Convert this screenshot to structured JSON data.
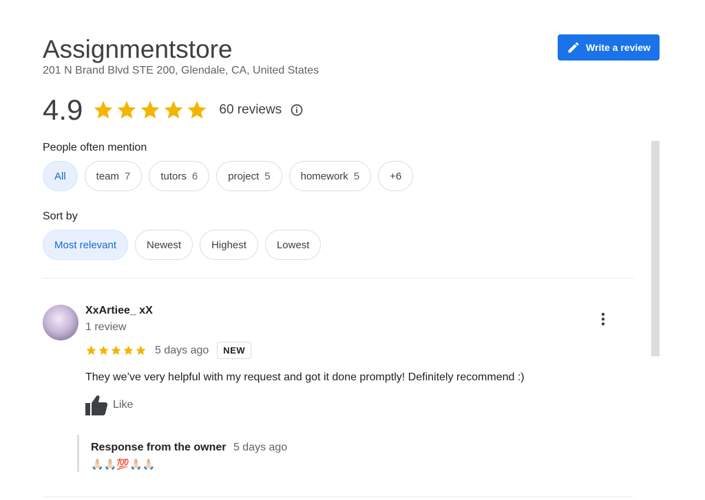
{
  "business": {
    "name": "Assignmentstore",
    "address": "201 N Brand Blvd STE 200, Glendale, CA, United States"
  },
  "actions": {
    "write_review_label": "Write a review"
  },
  "rating": {
    "value": "4.9",
    "stars": 5,
    "reviews_count_label": "60 reviews"
  },
  "mentions": {
    "label": "People often mention",
    "chips": [
      {
        "label": "All",
        "count": "",
        "selected": true
      },
      {
        "label": "team",
        "count": "7",
        "selected": false
      },
      {
        "label": "tutors",
        "count": "6",
        "selected": false
      },
      {
        "label": "project",
        "count": "5",
        "selected": false
      },
      {
        "label": "homework",
        "count": "5",
        "selected": false
      },
      {
        "label": "+6",
        "count": "",
        "selected": false
      }
    ]
  },
  "sort": {
    "label": "Sort by",
    "options": [
      {
        "label": "Most relevant",
        "selected": true
      },
      {
        "label": "Newest",
        "selected": false
      },
      {
        "label": "Highest",
        "selected": false
      },
      {
        "label": "Lowest",
        "selected": false
      }
    ]
  },
  "review": {
    "author": "XxArtiee_ xX",
    "author_meta": "1 review",
    "stars": 5,
    "date": "5 days ago",
    "badge": "NEW",
    "text": "They we’ve very helpful with my request and got it done promptly! Definitely recommend :)",
    "like_label": "Like",
    "owner_response": {
      "title": "Response from the owner",
      "date": "5 days ago",
      "text": "🙏🏻🙏🏻💯🙏🏻🙏🏻"
    }
  },
  "colors": {
    "accent": "#1a73e8",
    "star": "#f4b400",
    "chip_selected_bg": "#e8f0fe"
  },
  "icons": {
    "write_review": "pencil-icon",
    "info": "info-icon",
    "menu": "more-vert-icon",
    "like": "thumbs-up-icon"
  }
}
